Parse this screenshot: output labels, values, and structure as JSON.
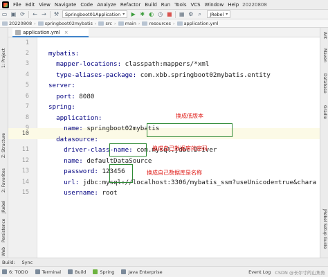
{
  "window": {
    "project_name": "20220808",
    "menu": [
      "File",
      "Edit",
      "View",
      "Navigate",
      "Code",
      "Analyze",
      "Refactor",
      "Build",
      "Run",
      "Tools",
      "VCS",
      "Window",
      "Help"
    ]
  },
  "toolbar": {
    "run_config": "Springboot01Application",
    "jrebel": "JRebel"
  },
  "breadcrumb": [
    "20220808",
    "springboot02mybatis",
    "src",
    "main",
    "resources",
    "application.yml"
  ],
  "tab": {
    "label": "application.yml"
  },
  "side_tabs": {
    "left": [
      "1: Project",
      "Z: Structure",
      "2: Favorites",
      "JRebel",
      "Persistence",
      "Web"
    ],
    "right": [
      "Ant",
      "Maven",
      "Database",
      "Gradle",
      "JRebel Setup Guide"
    ]
  },
  "editor": {
    "current_line": 10,
    "lines": [
      {
        "n": "1",
        "key": "",
        "val": ""
      },
      {
        "n": "2",
        "key": "mybatis:",
        "val": ""
      },
      {
        "n": "3",
        "key": "  mapper-locations:",
        "val": " classpath:mappers/*xml"
      },
      {
        "n": "4",
        "key": "  type-aliases-package:",
        "val": " com.xbb.springboot02mybatis.entity"
      },
      {
        "n": "5",
        "key": "server:",
        "val": ""
      },
      {
        "n": "6",
        "key": "  port:",
        "val": " 8080"
      },
      {
        "n": "7",
        "key": "spring:",
        "val": ""
      },
      {
        "n": "8",
        "key": "  application:",
        "val": ""
      },
      {
        "n": "9",
        "key": "    name:",
        "val": " springboot02mybatis"
      },
      {
        "n": "10",
        "key": "  datasource:",
        "val": ""
      },
      {
        "n": "11",
        "key": "    driver-class-name:",
        "val": " com.mysql.jdbc.Driver"
      },
      {
        "n": "12",
        "key": "    name:",
        "val": " defaultDataSource"
      },
      {
        "n": "13",
        "key": "    password:",
        "val": " 123456"
      },
      {
        "n": "14",
        "key": "    url:",
        "val": " jdbc:mysql://localhost:3306/mybatis_ssm?useUnicode=true&chara"
      },
      {
        "n": "15",
        "key": "    username:",
        "val": " root"
      }
    ]
  },
  "annotations": {
    "driver_note": "换成低版本",
    "password_note": "换成自己数据库的密码",
    "username_note": "换成自己数据库是名称",
    "color": "#e0201c",
    "box_color": "#2e8a35"
  },
  "bottom_tools": [
    "Build:",
    "Sync"
  ],
  "status": {
    "items": [
      "6: TODO",
      "Terminal",
      "Build",
      "Spring",
      "Java Enterprise"
    ],
    "event_log": "Event Log",
    "watermark": "CSDN @长尔寸的山魚魚"
  }
}
